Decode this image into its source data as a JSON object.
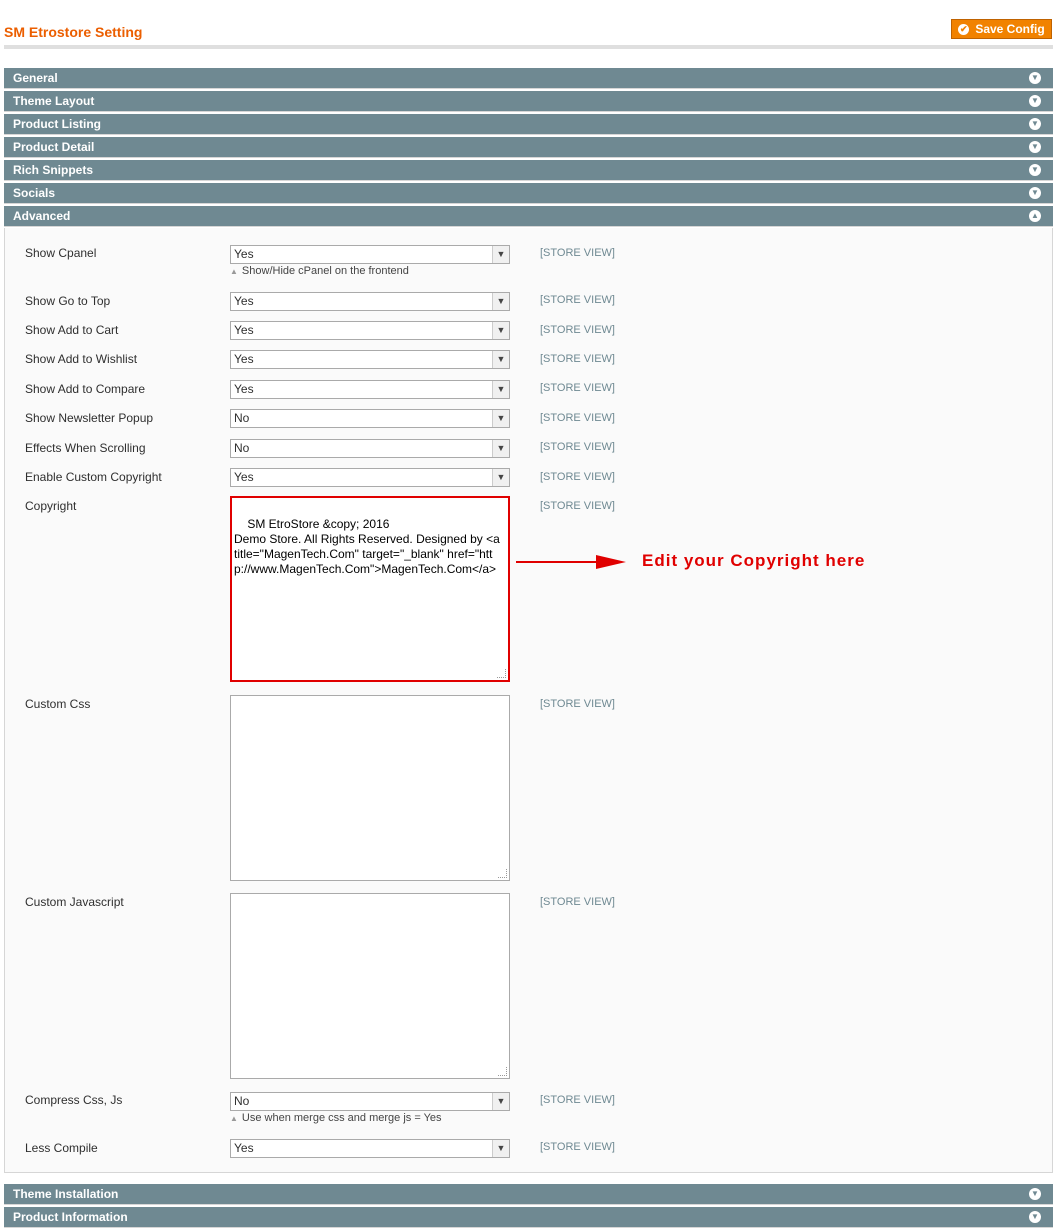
{
  "header": {
    "title": "SM Etrostore Setting",
    "save_label": "Save Config"
  },
  "sections_top": [
    {
      "label": "General",
      "state": "collapsed"
    },
    {
      "label": "Theme Layout",
      "state": "collapsed"
    },
    {
      "label": "Product Listing",
      "state": "collapsed"
    },
    {
      "label": "Product Detail",
      "state": "collapsed"
    },
    {
      "label": "Rich Snippets",
      "state": "collapsed"
    },
    {
      "label": "Socials",
      "state": "collapsed"
    },
    {
      "label": "Advanced",
      "state": "expanded"
    }
  ],
  "advanced": {
    "scope_label": "[STORE VIEW]",
    "fields": {
      "show_cpanel": {
        "label": "Show Cpanel",
        "value": "Yes",
        "note": "Show/Hide cPanel on the frontend"
      },
      "show_go_to_top": {
        "label": "Show Go to Top",
        "value": "Yes"
      },
      "show_add_to_cart": {
        "label": "Show Add to Cart",
        "value": "Yes"
      },
      "show_add_to_wishlist": {
        "label": "Show Add to Wishlist",
        "value": "Yes"
      },
      "show_add_to_compare": {
        "label": "Show Add to Compare",
        "value": "Yes"
      },
      "show_newsletter_popup": {
        "label": "Show Newsletter Popup",
        "value": "No"
      },
      "effects_when_scrolling": {
        "label": "Effects When Scrolling",
        "value": "No"
      },
      "enable_custom_copyright": {
        "label": "Enable Custom Copyright",
        "value": "Yes"
      },
      "copyright": {
        "label": "Copyright",
        "value": "SM EtroStore &copy; 2016\nDemo Store. All Rights Reserved. Designed by <a title=\"MagenTech.Com\" target=\"_blank\" href=\"http://www.MagenTech.Com\">MagenTech.Com</a>"
      },
      "custom_css": {
        "label": "Custom Css",
        "value": ""
      },
      "custom_javascript": {
        "label": "Custom Javascript",
        "value": ""
      },
      "compress_css_js": {
        "label": "Compress Css, Js",
        "value": "No",
        "note": "Use when merge css and merge js = Yes"
      },
      "less_compile": {
        "label": "Less Compile",
        "value": "Yes"
      }
    }
  },
  "sections_bottom": [
    {
      "label": "Theme Installation",
      "state": "collapsed"
    },
    {
      "label": "Product Information",
      "state": "collapsed"
    }
  ],
  "annotation": {
    "text": "Edit your Copyright here",
    "color": "#e00000"
  },
  "colors": {
    "section_bg": "#6f8992",
    "accent": "#eb5e00",
    "button": "#f18200"
  }
}
